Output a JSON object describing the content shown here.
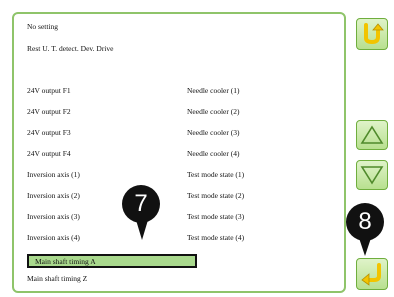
{
  "list": {
    "top_items": [
      "No setting",
      "Rest U. T. detect. Dev. Drive"
    ],
    "left_items": [
      "24V output F1",
      "24V output F2",
      "24V output F3",
      "24V output F4",
      "Inversion axis (1)",
      "Inversion axis (2)",
      "Inversion axis (3)",
      "Inversion axis (4)"
    ],
    "right_items": [
      "Needle cooler (1)",
      "Needle cooler (2)",
      "Needle cooler (3)",
      "Needle cooler (4)",
      "Test mode state (1)",
      "Test mode state (2)",
      "Test mode state (3)",
      "Test mode state (4)"
    ],
    "selected_item": "Main shaft timing A",
    "last_item": "Main shaft timing Z"
  },
  "buttons": {
    "return_icon": "return-arrow-icon",
    "up_icon": "triangle-up-icon",
    "down_icon": "triangle-down-icon",
    "enter_icon": "enter-arrow-icon"
  },
  "callouts": {
    "label_7": "7",
    "label_8": "8"
  },
  "colors": {
    "accent_green": "#8fc46a",
    "selected_row": "#a9d98d",
    "icon_yellow": "#f2c400"
  }
}
